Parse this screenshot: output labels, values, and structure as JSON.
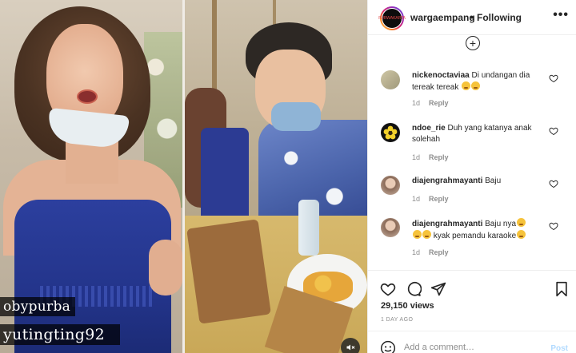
{
  "media": {
    "overlay_tags": [
      "obypurba",
      "yutingting92"
    ]
  },
  "header": {
    "account_name": "wargaempang",
    "avatar_text": "PURWAKARTA",
    "separator": "•",
    "follow_status": "Following",
    "more_label": "•••"
  },
  "load_more_label": "+",
  "comments": [
    {
      "user": "nickenoctaviaa",
      "text": "Di undangan dia tereak tereak",
      "emoji_count": 2,
      "age": "1d",
      "reply": "Reply"
    },
    {
      "user": "ndoe_rie",
      "text": "Duh yang katanya anak solehah",
      "emoji_count": 0,
      "age": "1d",
      "reply": "Reply"
    },
    {
      "user": "diajengrahmayanti",
      "text": "Baju",
      "emoji_count": 0,
      "age": "1d",
      "reply": "Reply"
    },
    {
      "user": "diajengrahmayanti",
      "text": "Baju nya",
      "text2": "kyak pemandu karaoke",
      "emoji_count": 4,
      "age": "1d",
      "reply": "Reply"
    }
  ],
  "stats": {
    "views": "29,150 views",
    "posted": "1 DAY AGO"
  },
  "add_comment": {
    "placeholder": "Add a comment…",
    "post_label": "Post"
  },
  "colors": {
    "post_disabled": "#b3dbff",
    "meta_gray": "#8e8e8e",
    "text": "#262626"
  }
}
